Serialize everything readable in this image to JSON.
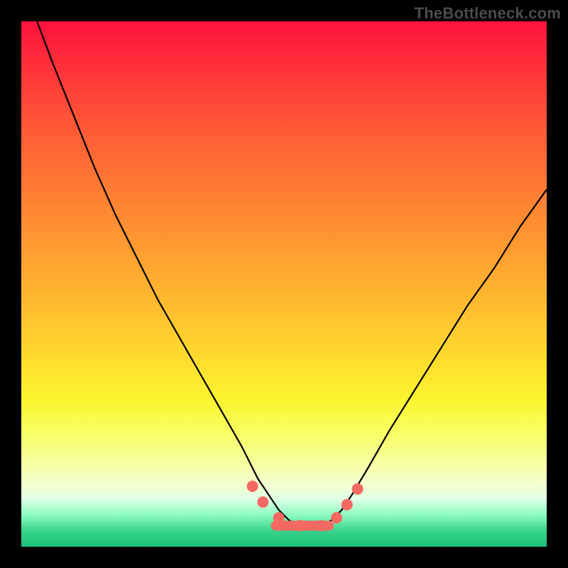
{
  "watermark": "TheBottleneck.com",
  "chart_data": {
    "type": "line",
    "title": "",
    "xlabel": "",
    "ylabel": "",
    "xlim": [
      0,
      100
    ],
    "ylim": [
      0,
      100
    ],
    "series": [
      {
        "name": "curve",
        "x": [
          3,
          6,
          10,
          14,
          18,
          22,
          26,
          30,
          34,
          38,
          42,
          45,
          47,
          49,
          51,
          53,
          55,
          57,
          59,
          61,
          63,
          66,
          70,
          75,
          80,
          85,
          90,
          95,
          100
        ],
        "values": [
          100,
          92,
          82,
          72,
          63,
          55,
          47,
          40,
          33,
          26,
          19,
          13,
          10,
          7,
          5,
          4,
          4,
          4,
          5,
          7,
          10,
          15,
          22,
          30,
          38,
          46,
          53,
          61,
          68
        ]
      }
    ],
    "markers": {
      "name": "highlight-dots",
      "color": "#f46a62",
      "x": [
        44,
        46,
        49,
        53,
        57,
        60,
        62,
        64
      ],
      "values": [
        11.5,
        8.5,
        5.5,
        4,
        4,
        5.5,
        8.0,
        11.0
      ],
      "radius": 8
    },
    "flat_band": {
      "name": "valley-bar",
      "color": "#f46a62",
      "x_start": 47.5,
      "x_end": 59.5,
      "y": 4,
      "thickness": 14
    }
  }
}
